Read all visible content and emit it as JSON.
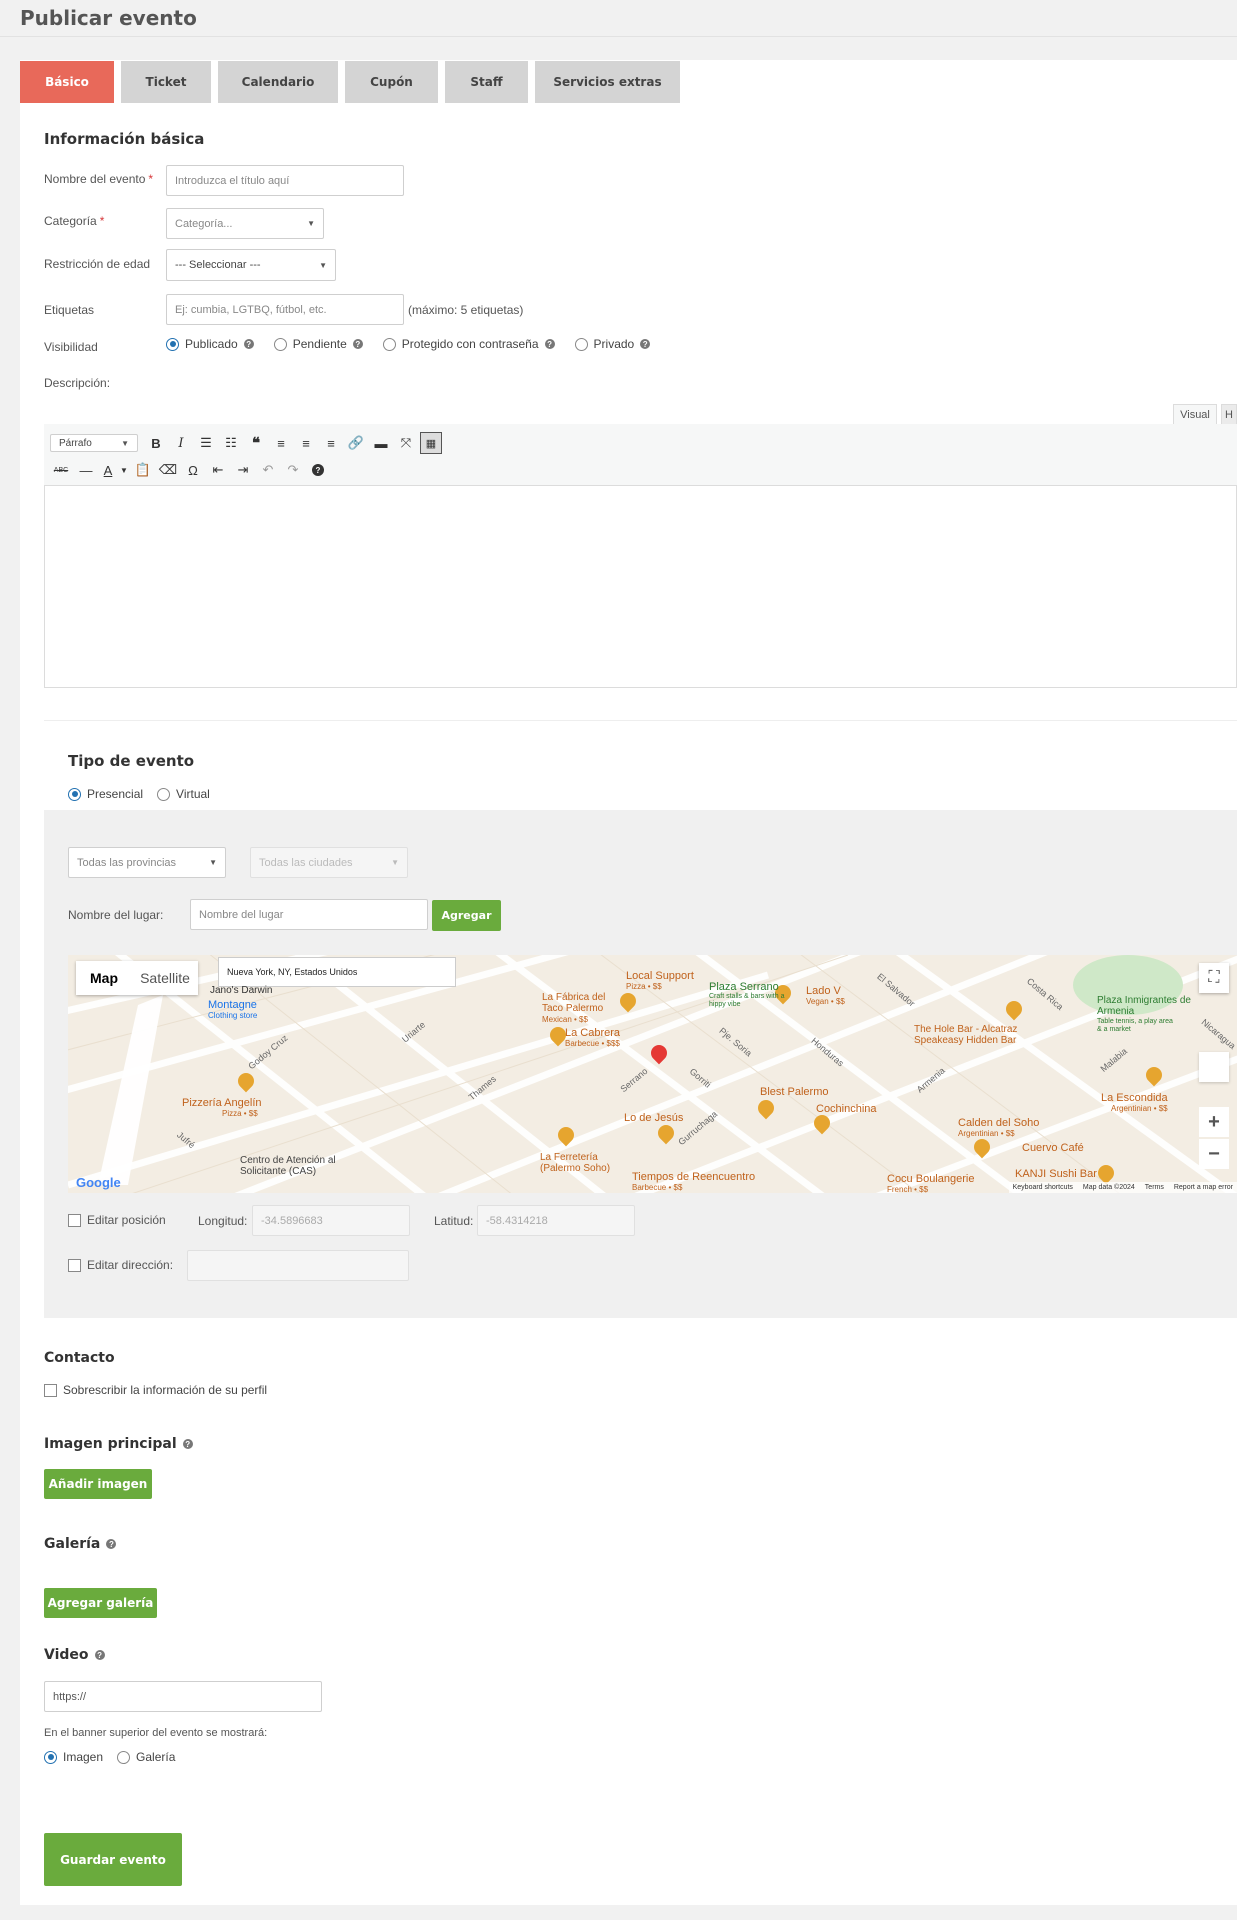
{
  "page": {
    "title": "Publicar evento"
  },
  "tabs": [
    {
      "label": "Básico",
      "active": true
    },
    {
      "label": "Ticket"
    },
    {
      "label": "Calendario"
    },
    {
      "label": "Cupón"
    },
    {
      "label": "Staff"
    },
    {
      "label": "Servicios extras"
    }
  ],
  "basic": {
    "heading": "Información básica",
    "name_label": "Nombre del evento",
    "name_placeholder": "Introduzca el título aquí",
    "category_label": "Categoría",
    "category_value": "Categoría...",
    "age_label": "Restricción de edad",
    "age_value": "--- Seleccionar ---",
    "tags_label": "Etiquetas",
    "tags_placeholder": "Ej: cumbia, LGTBQ, fútbol, etc.",
    "tags_hint": "(máximo: 5 etiquetas)",
    "visibility_label": "Visibilidad",
    "visibility_options": [
      "Publicado",
      "Pendiente",
      "Protegido con contraseña",
      "Privado"
    ],
    "description_label": "Descripción:"
  },
  "editor": {
    "tab_visual": "Visual",
    "tab_html": "H",
    "format_value": "Párrafo",
    "abc": "ABC",
    "font_color": "A"
  },
  "event_type": {
    "heading": "Tipo de evento",
    "options": [
      "Presencial",
      "Virtual"
    ],
    "province_value": "Todas las provincias",
    "city_value": "Todas las ciudades",
    "place_label": "Nombre del lugar:",
    "place_placeholder": "Nombre del lugar",
    "add_button": "Agregar",
    "edit_position_label": "Editar posición",
    "longitude_label": "Longitud:",
    "longitude_value": "-34.5896683",
    "latitude_label": "Latitud:",
    "latitude_value": "-58.4314218",
    "edit_address_label": "Editar dirección:"
  },
  "map": {
    "tab_map": "Map",
    "tab_satellite": "Satellite",
    "address": "Nueva York, NY, Estados Unidos",
    "google": "Google",
    "footer": [
      "Keyboard shortcuts",
      "Map data ©2024",
      "Terms",
      "Report a map error"
    ],
    "labels": [
      {
        "text": "Jano's Darwin",
        "kind": "dark"
      },
      {
        "text": "Montagne",
        "kind": "blue"
      },
      {
        "text": "Clothing store",
        "kind": "blue-small"
      },
      {
        "text": "Local Support",
        "kind": "orange"
      },
      {
        "text": "Pizza • $$",
        "kind": "small"
      },
      {
        "text": "Plaza Serrano",
        "kind": "green"
      },
      {
        "text": "Craft stalls & bars with a hippy vibe",
        "kind": "green-small"
      },
      {
        "text": "Lado V",
        "kind": "orange"
      },
      {
        "text": "Vegan • $$",
        "kind": "small"
      },
      {
        "text": "La Fábrica del Taco Palermo",
        "kind": "orange"
      },
      {
        "text": "Mexican • $$",
        "kind": "small"
      },
      {
        "text": "La Cabrera",
        "kind": "orange"
      },
      {
        "text": "Barbecue • $$$",
        "kind": "small"
      },
      {
        "text": "Plaza Inmigrantes de Armenia",
        "kind": "green"
      },
      {
        "text": "Table tennis, a play area & a market",
        "kind": "green-small"
      },
      {
        "text": "The Hole Bar - Alcatraz Speakeasy Hidden Bar",
        "kind": "orange"
      },
      {
        "text": "Pizzería Angelín",
        "kind": "orange"
      },
      {
        "text": "Pizza • $$",
        "kind": "small"
      },
      {
        "text": "Blest Palermo",
        "kind": "orange"
      },
      {
        "text": "Cochinchina",
        "kind": "orange"
      },
      {
        "text": "La Escondida",
        "kind": "orange"
      },
      {
        "text": "Argentinian • $$",
        "kind": "small"
      },
      {
        "text": "Lo de Jesús",
        "kind": "orange"
      },
      {
        "text": "Calden del Soho",
        "kind": "orange"
      },
      {
        "text": "Argentinian • $$",
        "kind": "small"
      },
      {
        "text": "Cuervo Café",
        "kind": "orange"
      },
      {
        "text": "Centro de Atención al Solicitante (CAS)",
        "kind": "dark"
      },
      {
        "text": "La Ferretería (Palermo Soho)",
        "kind": "orange"
      },
      {
        "text": "Tiempos de Reencuentro",
        "kind": "orange"
      },
      {
        "text": "Barbecue • $$",
        "kind": "small"
      },
      {
        "text": "Cocu Boulangerie",
        "kind": "orange"
      },
      {
        "text": "French • $$",
        "kind": "small"
      },
      {
        "text": "KANJI Sushi Bar",
        "kind": "orange"
      }
    ],
    "streets": [
      "Godoy Cruz",
      "Uriarte",
      "Thames",
      "Serrano",
      "Gorriti",
      "Honduras",
      "El Salvador",
      "Costa Rica",
      "Malabia",
      "Armenia",
      "Gurruchaga",
      "Jufré",
      "Pje. Soria",
      "Nicaragua"
    ]
  },
  "contact": {
    "heading": "Contacto",
    "override_label": "Sobrescribir la información de su perfil"
  },
  "main_image": {
    "heading": "Imagen principal",
    "button": "Añadir imagen"
  },
  "gallery": {
    "heading": "Galería",
    "button": "Agregar galería"
  },
  "video": {
    "heading": "Video",
    "placeholder": "https://",
    "banner_label": "En el banner superior del evento se mostrará:",
    "options": [
      "Imagen",
      "Galería"
    ]
  },
  "save_button": "Guardar evento"
}
